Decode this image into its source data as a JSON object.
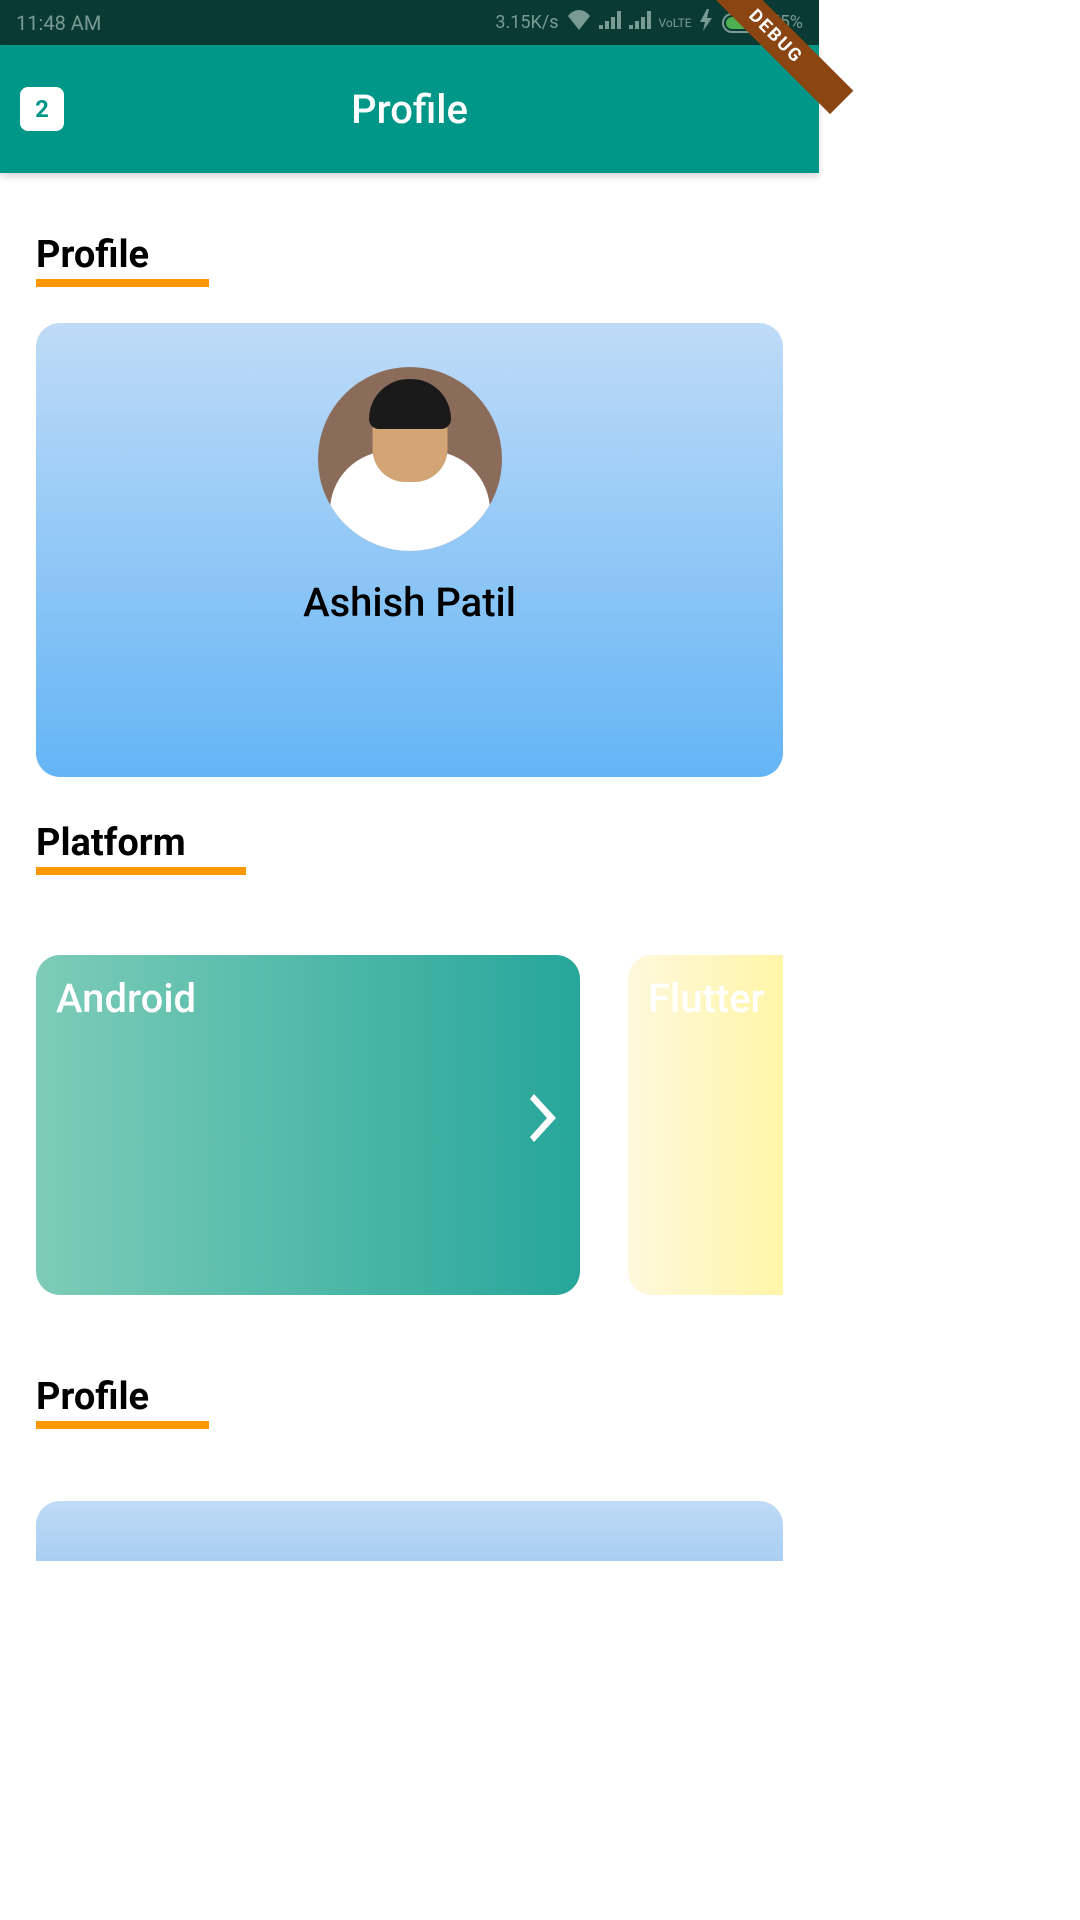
{
  "statusBar": {
    "time": "11:48 AM",
    "networkSpeed": "3.15K/s",
    "lte": "VoLTE",
    "battery": "75%"
  },
  "appBar": {
    "iconText": "2",
    "title": "Profile"
  },
  "debugBanner": "DEBUG",
  "sections": {
    "profile1": {
      "title": "Profile",
      "name": "Ashish Patil"
    },
    "platform": {
      "title": "Platform",
      "cards": [
        {
          "label": "Android"
        },
        {
          "label": "Flutter"
        }
      ]
    },
    "profile2": {
      "title": "Profile"
    }
  }
}
